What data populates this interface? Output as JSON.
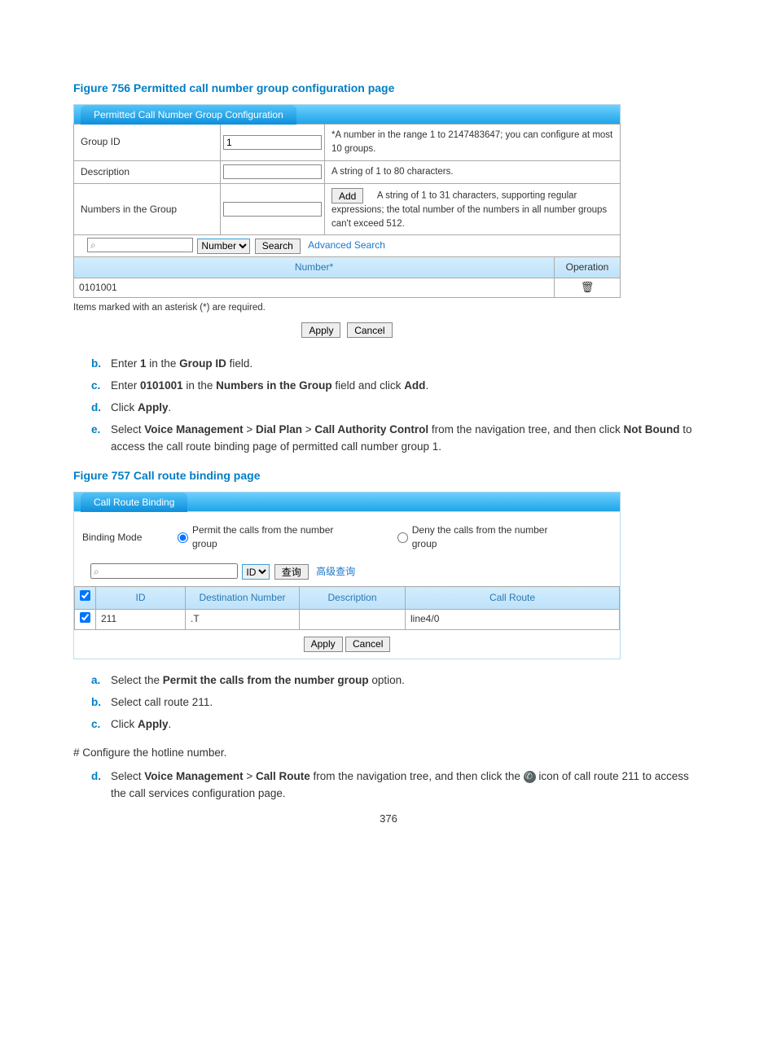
{
  "page_number": "376",
  "fig756": {
    "caption": "Figure 756 Permitted call number group configuration page",
    "tab_title": "Permitted Call Number Group Configuration",
    "rows": {
      "group_id": {
        "label": "Group ID",
        "value": "1",
        "help": "*A number in the range 1 to 2147483647; you can configure at most 10 groups."
      },
      "description": {
        "label": "Description",
        "value": "",
        "help": "A string of 1 to 80 characters."
      },
      "numbers": {
        "label": "Numbers in the Group",
        "value": "",
        "add": "Add",
        "help": "A string of 1 to 31 characters, supporting regular expressions; the total number of the numbers in all number groups can't exceed 512."
      }
    },
    "search": {
      "placeholder": "",
      "select": "Number",
      "search_btn": "Search",
      "adv": "Advanced Search"
    },
    "header": {
      "num": "Number*",
      "op": "Operation"
    },
    "data_num": "0101001",
    "required_note": "Items marked with an asterisk (*) are required.",
    "apply": "Apply",
    "cancel": "Cancel"
  },
  "steps1": {
    "b": {
      "pre": "Enter ",
      "bold1": "1",
      "mid": " in the ",
      "bold2": "Group ID",
      "post": " field."
    },
    "c": {
      "pre": "Enter ",
      "bold1": "0101001",
      "mid": " in the ",
      "bold2": "Numbers in the Group",
      "post1": " field and click ",
      "bold3": "Add",
      "post2": "."
    },
    "d": {
      "pre": "Click ",
      "bold1": "Apply",
      "post": "."
    },
    "e": {
      "pre": "Select ",
      "b1": "Voice Management",
      "gt1": " > ",
      "b2": "Dial Plan",
      "gt2": " > ",
      "b3": "Call Authority Control",
      "mid": " from the navigation tree, and then click ",
      "b4": "Not Bound",
      "post": " to access the call route binding page of permitted call number group 1."
    }
  },
  "fig757": {
    "caption": "Figure 757 Call route binding page",
    "tab_title": "Call Route Binding",
    "binding_label": "Binding Mode",
    "opt_permit": "Permit the calls from the number group",
    "opt_deny": "Deny the calls from the number group",
    "search": {
      "select": "ID",
      "btn": "查询",
      "adv": "高级查询"
    },
    "headers": {
      "id": "ID",
      "dest": "Destination Number",
      "desc": "Description",
      "route": "Call Route"
    },
    "row": {
      "id": "211",
      "dest": ".T",
      "desc": "",
      "route": "line4/0"
    },
    "apply": "Apply",
    "cancel": "Cancel"
  },
  "steps2": {
    "a": {
      "pre": "Select the ",
      "bold1": "Permit the calls from the number group",
      "post": " option."
    },
    "b": "Select call route 211.",
    "c": {
      "pre": "Click ",
      "bold1": "Apply",
      "post": "."
    }
  },
  "hash_line": "# Configure the hotline number.",
  "step_d2": {
    "pre": "Select ",
    "b1": "Voice Management",
    "gt": " > ",
    "b2": "Call Route",
    "mid": " from the navigation tree, and then click the ",
    "post": " icon of call route 211 to access the call services configuration page."
  }
}
